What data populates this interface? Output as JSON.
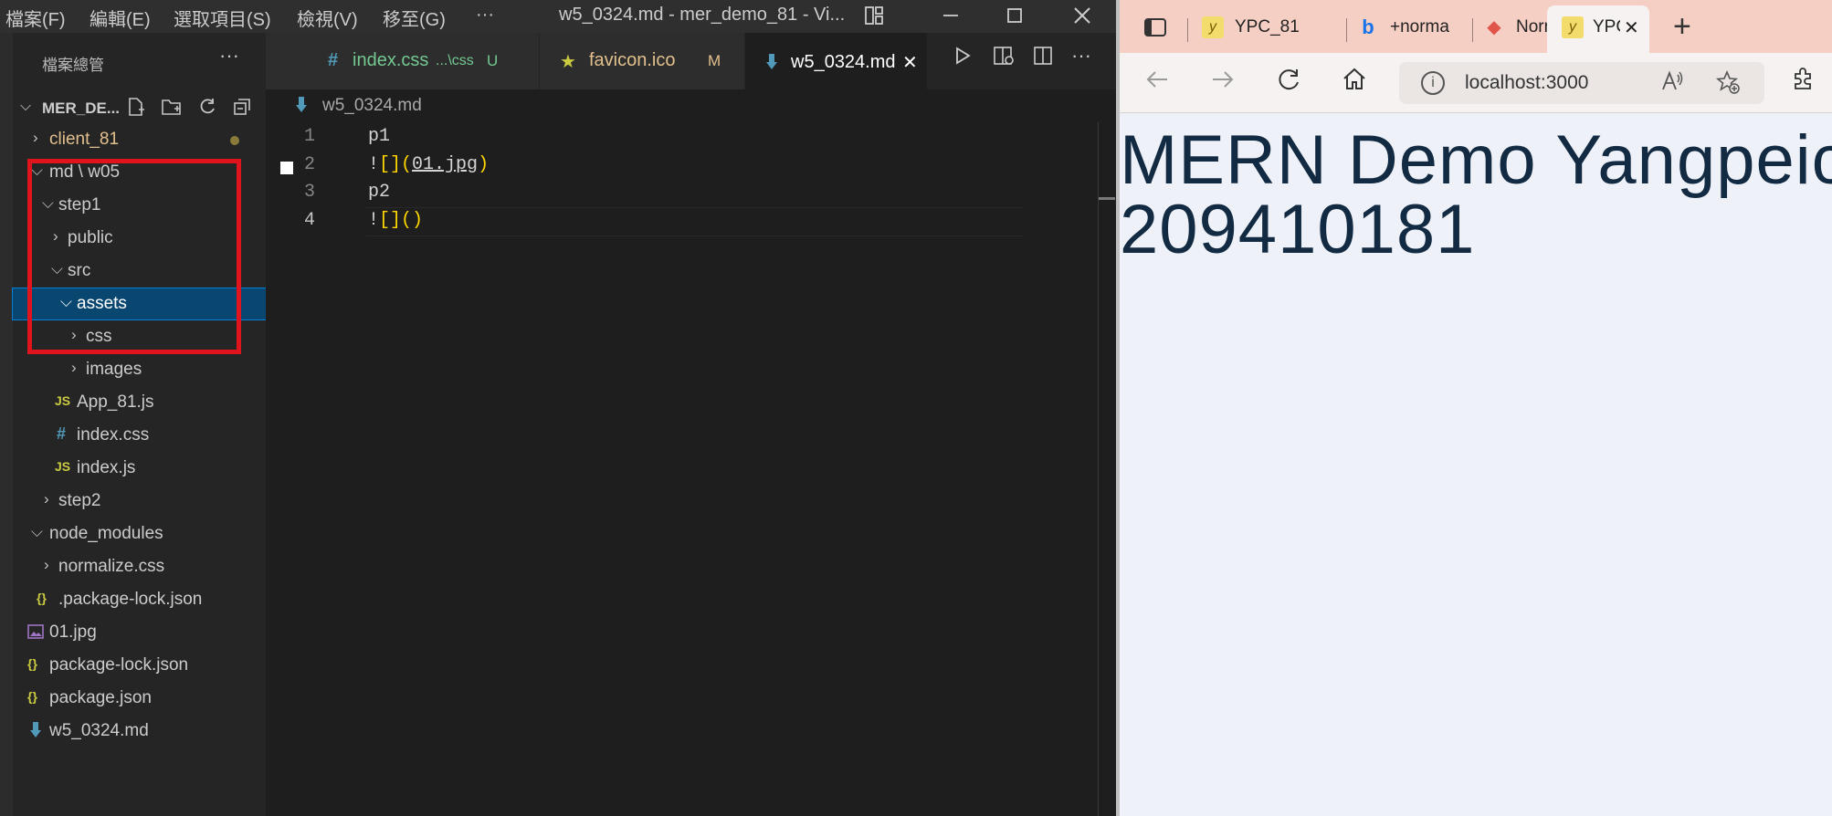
{
  "vscode": {
    "menu": [
      "檔案(F)",
      "編輯(E)",
      "選取項目(S)",
      "檢視(V)",
      "移至(G)",
      "···"
    ],
    "window_title": "w5_0324.md - mer_demo_81 - Vi...",
    "explorer": {
      "header": "檔案總管",
      "more": "···",
      "project": "MER_DE...",
      "items": [
        {
          "label": "client_81",
          "icon": "chevron-right",
          "status": "modified-dot",
          "color": "#e2c08d"
        },
        {
          "label": "md \\ w05",
          "icon": "chevron-down"
        },
        {
          "label": "step1",
          "icon": "chevron-down"
        },
        {
          "label": "public",
          "icon": "chevron-right"
        },
        {
          "label": "src",
          "icon": "chevron-down"
        },
        {
          "label": "assets",
          "icon": "chevron-down",
          "selected": true
        },
        {
          "label": "css",
          "icon": "chevron-right"
        },
        {
          "label": "images",
          "icon": "chevron-right"
        },
        {
          "label": "App_81.js",
          "icon": "js-file",
          "badge": "JS"
        },
        {
          "label": "index.css",
          "icon": "css-file",
          "badge": "#"
        },
        {
          "label": "index.js",
          "icon": "js-file",
          "badge": "JS"
        },
        {
          "label": "step2",
          "icon": "chevron-right"
        },
        {
          "label": "node_modules",
          "icon": "chevron-down"
        },
        {
          "label": "normalize.css",
          "icon": "chevron-right"
        },
        {
          "label": ".package-lock.json",
          "icon": "json-file",
          "badge": "{}"
        },
        {
          "label": "01.jpg",
          "icon": "image-file"
        },
        {
          "label": "package-lock.json",
          "icon": "json-file",
          "badge": "{}"
        },
        {
          "label": "package.json",
          "icon": "json-file",
          "badge": "{}"
        },
        {
          "label": "w5_0324.md",
          "icon": "markdown-file"
        }
      ]
    },
    "tabs": [
      {
        "badge": "#",
        "label": "index.css",
        "path": "...\\css",
        "status": "U",
        "color": "#73c991"
      },
      {
        "badge": "★",
        "label": "favicon.ico",
        "status": "M",
        "color": "#e2c08d"
      },
      {
        "label": "w5_0324.md",
        "active": true,
        "close": "✕",
        "color": "#ffffff"
      }
    ],
    "breadcrumb": "w5_0324.md",
    "code_lines": [
      {
        "num": "1",
        "text": "p1"
      },
      {
        "num": "2",
        "text": "![](01.jpg)"
      },
      {
        "num": "3",
        "text": "p2"
      },
      {
        "num": "4",
        "text": "![]()"
      }
    ]
  },
  "browser": {
    "tabs": [
      {
        "favicon": "y",
        "label": "YPC_81"
      },
      {
        "favicon": "b",
        "label": "+norma"
      },
      {
        "favicon": "◆",
        "label": "Normali"
      },
      {
        "favicon": "y",
        "label": "YPC",
        "active": true,
        "close": "✕"
      }
    ],
    "new_tab": "+",
    "address": "localhost:3000",
    "info_icon": "i",
    "page": {
      "line1": "MERN Demo Yangpeici",
      "line2": "209410181"
    }
  }
}
